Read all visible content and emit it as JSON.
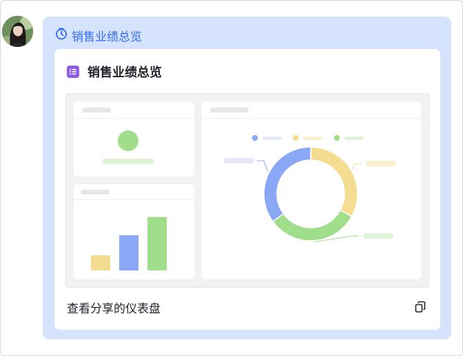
{
  "message": {
    "header_title": "销售业绩总览",
    "card_title": "销售业绩总览",
    "footer_link": "查看分享的仪表盘"
  },
  "icons": {
    "header": "clock-icon",
    "doc": "list-doc-icon",
    "copy": "copy-icon"
  },
  "colors": {
    "bubble_bg": "#d6e3fd",
    "accent": "#2f6bf2",
    "doc_icon": "#8f5be8",
    "blue": "#8aa8f5",
    "yellow": "#f4dc90",
    "green": "#a0de8c"
  },
  "chart_data": [
    {
      "type": "bar",
      "categories": [
        "",
        "",
        ""
      ],
      "values": [
        25,
        58,
        88
      ],
      "colors": [
        "#f4dc90",
        "#8aa8f5",
        "#a0de8c"
      ],
      "ylim": [
        0,
        100
      ]
    },
    {
      "type": "pie",
      "variant": "donut",
      "values": [
        33,
        32,
        35
      ],
      "colors": [
        "#f4dc90",
        "#a0de8c",
        "#8aa8f5"
      ],
      "legend_colors": [
        "#8aa8f5",
        "#f4dc90",
        "#a0de8c"
      ]
    }
  ]
}
